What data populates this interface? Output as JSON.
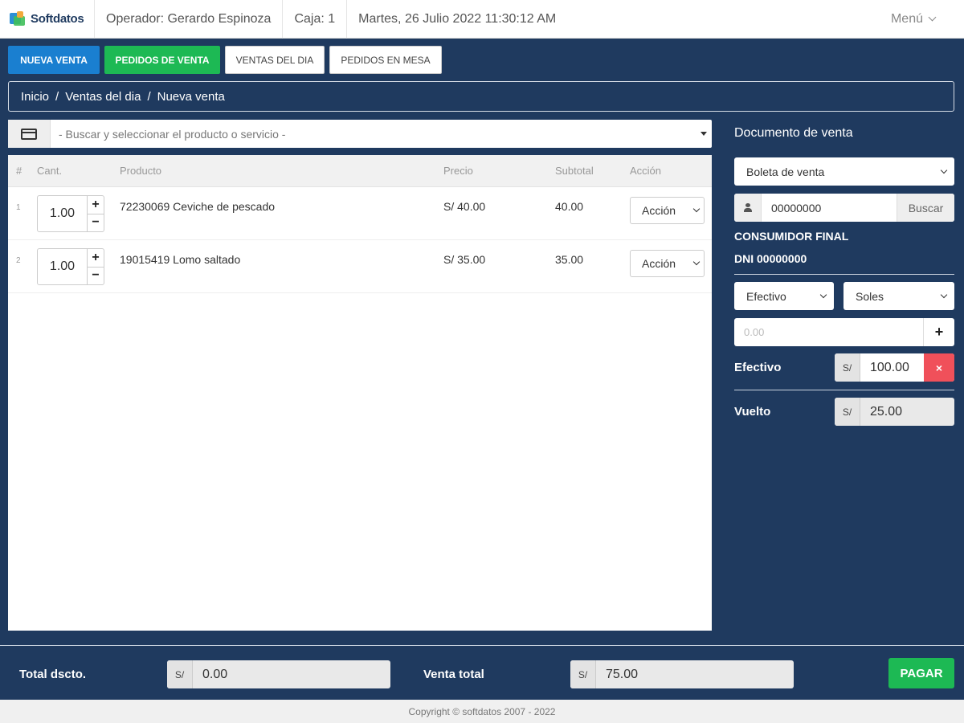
{
  "topbar": {
    "brand": "Softdatos",
    "operator": "Operador: Gerardo Espinoza",
    "register": "Caja: 1",
    "datetime": "Martes, 26 Julio 2022 11:30:12 AM",
    "menu_label": "Menú",
    "menu_icon": "chevron-down-icon"
  },
  "nav": {
    "new_sale": "NUEVA VENTA",
    "sales_orders": "PEDIDOS DE VENTA",
    "day_sales": "VENTAS DEL DIA",
    "table_orders": "PEDIDOS EN MESA"
  },
  "breadcrumb": [
    "Inicio",
    "Ventas del dia",
    "Nueva venta"
  ],
  "search": {
    "icon": "card-icon",
    "placeholder": "- Buscar y seleccionar el producto o servicio -"
  },
  "table": {
    "headers": [
      "#",
      "Cant.",
      "Producto",
      "Precio",
      "Subtotal",
      "Acción"
    ],
    "rows": [
      {
        "n": "1",
        "qty": "1.00",
        "product": "72230069 Ceviche de pescado",
        "price": "S/ 40.00",
        "subtotal": "40.00",
        "action": "Acción"
      },
      {
        "n": "2",
        "qty": "1.00",
        "product": "19015419 Lomo saltado",
        "price": "S/ 35.00",
        "subtotal": "35.00",
        "action": "Acción"
      }
    ],
    "plus": "+",
    "minus": "−"
  },
  "document": {
    "title": "Documento de venta",
    "doc_type": "Boleta de venta",
    "dni_value": "00000000",
    "search_button": "Buscar",
    "client_name": "CONSUMIDOR FINAL",
    "client_dni": "DNI 00000000",
    "payment_method": "Efectivo",
    "currency": "Soles",
    "amount_placeholder": "0.00",
    "add_symbol": "+",
    "cash_label": "Efectivo",
    "currency_symbol": "S/",
    "cash_amount": "100.00",
    "remove_symbol": "×",
    "change_label": "Vuelto",
    "change_amount": "25.00"
  },
  "totals": {
    "discount_label": "Total dscto.",
    "discount_value": "0.00",
    "total_label": "Venta total",
    "total_value": "75.00",
    "currency_symbol": "S/",
    "pay_button": "PAGAR"
  },
  "footer": {
    "copyright": "Copyright © softdatos 2007 - 2022"
  },
  "colors": {
    "background": "#1f3a5f",
    "primary_blue": "#1a7fd0",
    "success_green": "#1db954",
    "danger_red": "#f0505a"
  }
}
